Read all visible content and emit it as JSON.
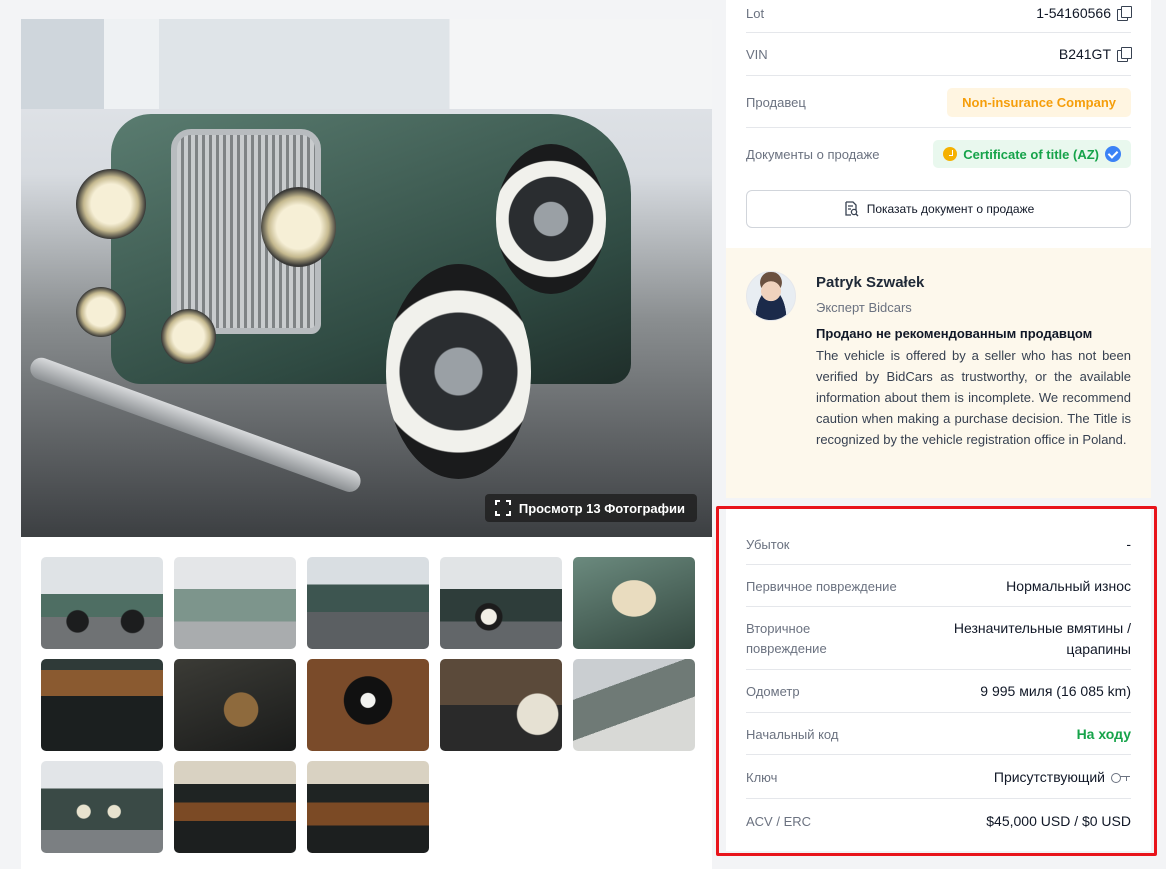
{
  "gallery": {
    "view_photos_label": "Просмотр 13 Фотографии",
    "thumbnail_count": 13
  },
  "lot_info": {
    "lot_label": "Lot",
    "lot_value": "1-54160566",
    "vin_label": "VIN",
    "vin_value": "B241GT",
    "seller_label": "Продавец",
    "seller_value": "Non-insurance Company",
    "docs_label": "Документы о продаже",
    "docs_value": "Certificate of title (AZ)",
    "show_doc_button": "Показать документ о продаже"
  },
  "expert": {
    "name": "Patryk Szwałek",
    "role": "Эксперт Bidcars",
    "heading": "Продано не рекомендованным продавцом",
    "text": "The vehicle is offered by a seller who has not been verified by BidCars as trustworthy, or the available information about them is incomplete. We recommend caution when making a purchase decision. The Title is recognized by the vehicle registration office in Poland."
  },
  "details": {
    "loss_label": "Убыток",
    "loss_value": "-",
    "primary_damage_label": "Первичное повреждение",
    "primary_damage_value": "Нормальный износ",
    "secondary_damage_label_1": "Вторичное",
    "secondary_damage_label_2": "повреждение",
    "secondary_damage_value_1": "Незначительные вмятины /",
    "secondary_damage_value_2": "царапины",
    "odometer_label": "Одометр",
    "odometer_value": "9 995 миля (16 085 km)",
    "start_code_label": "Начальный код",
    "start_code_value": "На ходу",
    "key_label": "Ключ",
    "key_value": "Присутствующий",
    "acv_label": "ACV / ERC",
    "acv_value": "$45,000 USD / $0 USD"
  },
  "colors": {
    "accent_green": "#16a34a",
    "accent_orange": "#f59e0b",
    "highlight_red": "#e8141b",
    "verified_blue": "#3b82f6"
  },
  "icons": [
    "copy-icon",
    "expand-icon",
    "document-search-icon",
    "key-icon",
    "verified-icon",
    "check-circle-icon"
  ]
}
